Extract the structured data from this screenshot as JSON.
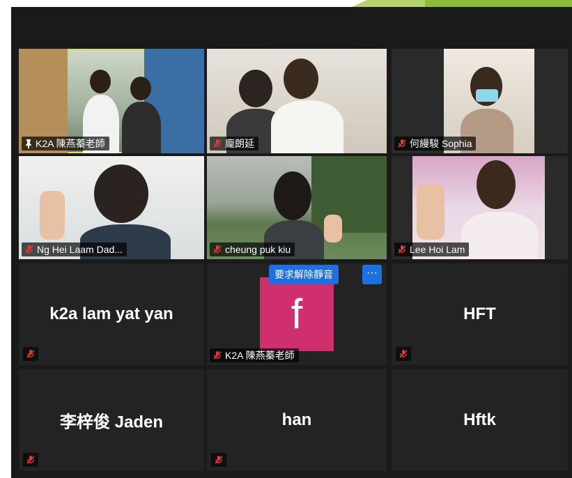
{
  "meeting": {
    "tiles": [
      {
        "id": "t1",
        "name": "K2A 陳燕蓁老師",
        "pinned": true,
        "muted": false,
        "video": true,
        "active": true
      },
      {
        "id": "t2",
        "name": "龐朗延",
        "muted": true,
        "video": true
      },
      {
        "id": "t3",
        "name": "何縵駿 Sophia",
        "muted": true,
        "video": true
      },
      {
        "id": "t4",
        "name": "Ng Hei Laam Dad...",
        "muted": true,
        "video": true
      },
      {
        "id": "t5",
        "name": "cheung puk kiu",
        "muted": true,
        "video": true
      },
      {
        "id": "t6",
        "name": "Lee Hoi Lam",
        "muted": true,
        "video": true
      },
      {
        "id": "t7",
        "name": "k2a lam yat yan",
        "muted": true,
        "video": false
      },
      {
        "id": "t8",
        "name": "K2A 陳燕蓁老師",
        "muted": true,
        "video": false,
        "avatar_letter": "f"
      },
      {
        "id": "t9",
        "name": "HFT",
        "muted": true,
        "video": false
      },
      {
        "id": "t10",
        "name": "李梓俊 Jaden",
        "muted": true,
        "video": false
      },
      {
        "id": "t11",
        "name": "han",
        "muted": true,
        "video": false
      },
      {
        "id": "t12",
        "name": "Hftk",
        "muted": true,
        "video": false
      }
    ],
    "hover_actions": {
      "ask_unmute_label": "要求解除靜音",
      "more_label": "···"
    }
  },
  "colors": {
    "accent_active": "#d4e157",
    "button_blue": "#1e6fe0",
    "muted_red": "#e53935",
    "avatar_pink": "#cf2f6d"
  },
  "icons": {
    "muted": "mic-muted-icon",
    "pin": "pin-icon",
    "more": "more-icon"
  }
}
